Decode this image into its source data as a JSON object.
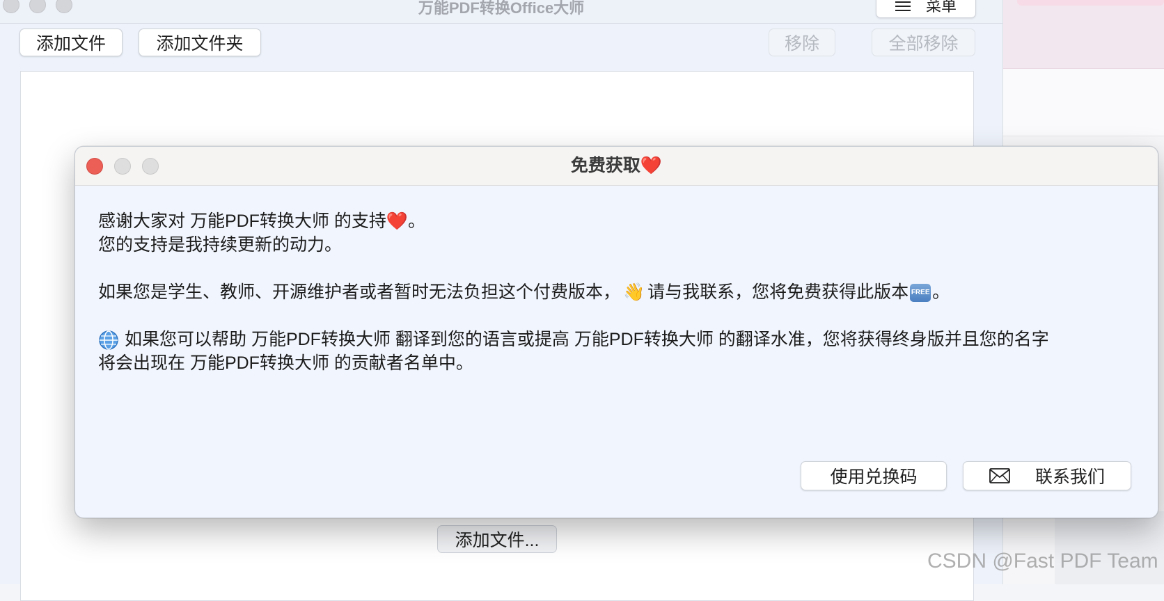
{
  "main_window": {
    "title": "万能PDF转换Office大师",
    "menu_label": "菜单",
    "toolbar": {
      "add_file": "添加文件",
      "add_folder": "添加文件夹",
      "remove": "移除",
      "remove_all": "全部移除"
    },
    "add_more_button": "添加文件..."
  },
  "dialog": {
    "title": "免费获取❤️",
    "line1": "感谢大家对 万能PDF转换大师 的支持❤️。",
    "line2": "您的支持是我持续更新的动力。",
    "line3_part1": "如果您是学生、教师、开源维护者或者暂时无法负担这个付费版本，",
    "line3_wave": "👋",
    "line3_part2": "请与我联系，您将免费获得此版本",
    "line3_free": "FREE",
    "line3_end": "。",
    "line4": "如果您可以帮助  万能PDF转换大师 翻译到您的语言或提高 万能PDF转换大师 的翻译水准，您将获得终身版并且您的名字",
    "line5": "将会出现在 万能PDF转换大师 的贡献者名单中。",
    "redeem_button": "使用兑换码",
    "contact_button": "联系我们"
  },
  "watermark": "CSDN @Fast PDF Team",
  "colors": {
    "close_red": "#ec5f57",
    "dialog_bg": "#f1f5fd",
    "heart": "#e0293a"
  },
  "icons": [
    "menu-icon",
    "globe-icon",
    "wave-emoji",
    "free-badge-icon",
    "envelope-icon"
  ]
}
